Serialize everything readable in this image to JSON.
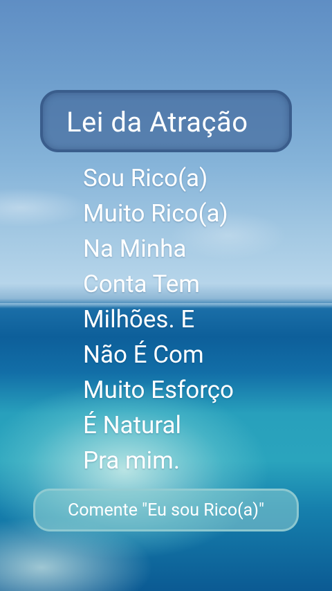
{
  "title": "Lei da Atração",
  "affirmation_lines": [
    "Sou Rico(a)",
    "Muito Rico(a)",
    "Na Minha",
    "Conta Tem",
    "Milhões. E",
    "Não É Com",
    "Muito Esforço",
    "É Natural",
    "Pra mim."
  ],
  "call_to_action": "Comente \"Eu sou Rico(a)\"",
  "colors": {
    "title_box_border": "#3a5d8c",
    "text": "#ffffff",
    "sky_top": "#5f8ec4",
    "sea": "#0d5f9a"
  }
}
